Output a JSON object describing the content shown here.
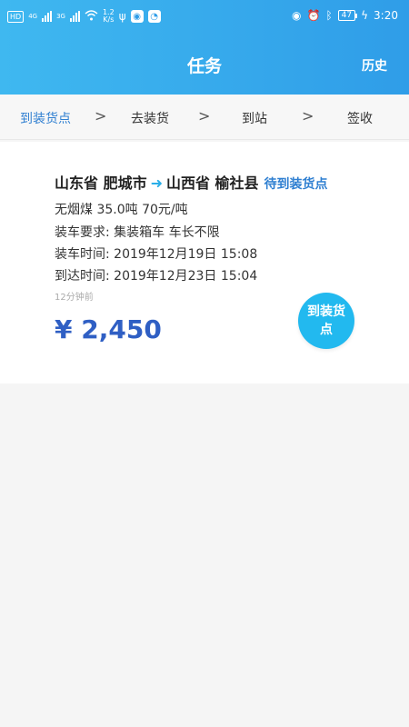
{
  "statusbar": {
    "hd": "HD",
    "net1": "4G",
    "net2": "3G",
    "speed_value": "1.2",
    "speed_unit": "K/s",
    "battery": "47",
    "time": "3:20"
  },
  "header": {
    "title": "任务",
    "history": "历史"
  },
  "steps": [
    {
      "label": "到装货点"
    },
    {
      "label": "去装货"
    },
    {
      "label": "到站"
    },
    {
      "label": "签收"
    }
  ],
  "task": {
    "origin": "山东省 肥城市",
    "destination": "山西省 榆社县",
    "status": "待到装货点",
    "cargo": "无烟煤 35.0吨 70元/吨",
    "requirement": "装车要求: 集装箱车 车长不限",
    "load_time": "装车时间: 2019年12月19日 15:08",
    "arrive_time": "到达时间: 2019年12月23日 15:04",
    "posted": "12分钟前",
    "price": "¥ 2,450",
    "action": "到装货点"
  },
  "colors": {
    "header_start": "#3fb8f0",
    "header_end": "#2f9de8",
    "active_step": "#2f7fd1",
    "price": "#2f5fc4",
    "action_button": "#22b9ef"
  }
}
